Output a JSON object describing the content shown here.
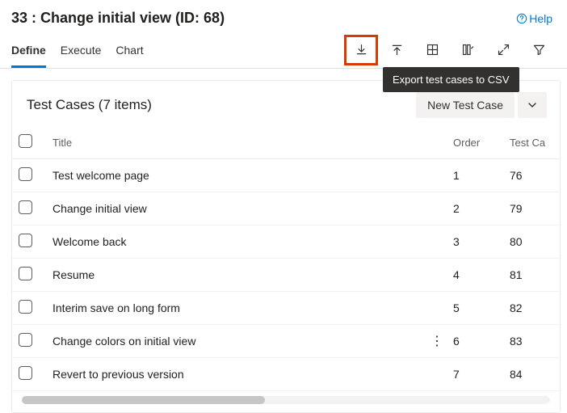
{
  "header": {
    "title": "33 : Change initial view (ID: 68)",
    "help_label": "Help"
  },
  "tabs": {
    "define": "Define",
    "execute": "Execute",
    "chart": "Chart"
  },
  "actions": {
    "export_tooltip": "Export test cases to CSV"
  },
  "card": {
    "title": "Test Cases (7 items)",
    "new_button": "New Test Case"
  },
  "columns": {
    "title": "Title",
    "order": "Order",
    "tcid": "Test Ca"
  },
  "rows": [
    {
      "title": "Test welcome page",
      "order": "1",
      "tcid": "76",
      "kebab": false
    },
    {
      "title": "Change initial view",
      "order": "2",
      "tcid": "79",
      "kebab": false
    },
    {
      "title": "Welcome back",
      "order": "3",
      "tcid": "80",
      "kebab": false
    },
    {
      "title": "Resume",
      "order": "4",
      "tcid": "81",
      "kebab": false
    },
    {
      "title": "Interim save on long form",
      "order": "5",
      "tcid": "82",
      "kebab": false
    },
    {
      "title": "Change colors on initial view",
      "order": "6",
      "tcid": "83",
      "kebab": true
    },
    {
      "title": "Revert to previous version",
      "order": "7",
      "tcid": "84",
      "kebab": false
    }
  ]
}
